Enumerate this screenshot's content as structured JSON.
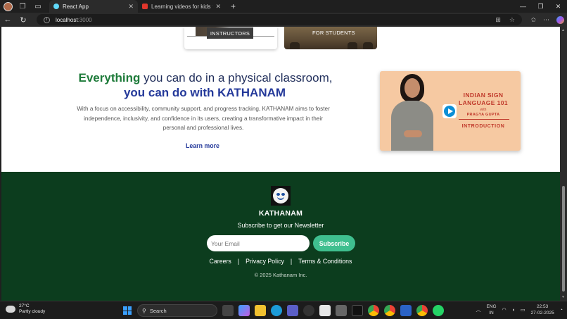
{
  "browser": {
    "tabs": [
      {
        "title": "React App",
        "active": true,
        "favicon_color": "#61dafb"
      },
      {
        "title": "Learning videos for kids with auti",
        "active": false,
        "favicon_color": "#e0362c"
      }
    ],
    "new_tab_label": "+",
    "url_host": "localhost",
    "url_port": ":3000"
  },
  "page": {
    "cards": {
      "instructors_label": "INSTRUCTORS",
      "students_label": "FOR STUDENTS"
    },
    "hero": {
      "accent_word": "Everything",
      "line1_rest": " you can do in a physical classroom,",
      "line2": "you can do with KATHANAM",
      "description": "With a focus on accessibility, community support, and progress tracking, KATHANAM aims to foster independence, inclusivity, and confidence in its users, creating a transformative impact in their personal and professional lives.",
      "learn_more": "Learn more"
    },
    "video_thumbnail": {
      "title": "INDIAN SIGN LANGUAGE 101",
      "with": "with",
      "presenter": "PRAGYA GUPTA",
      "subtitle": "INTRODUCTION"
    },
    "footer": {
      "brand": "KATHANAM",
      "subscribe_text": "Subscribe to get our Newsletter",
      "email_placeholder": "Your Email",
      "subscribe_button": "Subscribe",
      "links": [
        "Careers",
        "Privacy Policy",
        "Terms & Conditions"
      ],
      "separator": "|",
      "copyright": "© 2025 Kathanam Inc."
    }
  },
  "taskbar": {
    "weather_temp": "27°C",
    "weather_desc": "Partly cloudy",
    "search_label": "Search",
    "lang_line1": "ENG",
    "lang_line2": "IN",
    "time": "22:53",
    "date": "27-02-2025"
  },
  "colors": {
    "accent_green": "#1e7b3a",
    "heading_blue": "#24399a",
    "footer_bg": "#0c3d1e",
    "subscribe_button": "#3fbf8f"
  }
}
